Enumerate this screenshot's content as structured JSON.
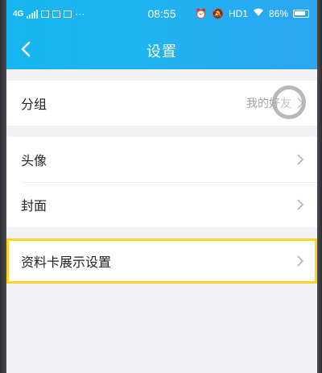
{
  "statusbar": {
    "network": "4G",
    "time": "08:55",
    "hd_label": "HD1",
    "battery": "86%"
  },
  "nav": {
    "title": "设置"
  },
  "settings": {
    "group": {
      "label": "分组",
      "value": "我的好友"
    },
    "avatar": {
      "label": "头像"
    },
    "cover": {
      "label": "封面"
    },
    "card_display": {
      "label": "资料卡展示设置"
    }
  },
  "colors": {
    "header": "#1fb3f2",
    "highlight": "#ffd21f"
  }
}
